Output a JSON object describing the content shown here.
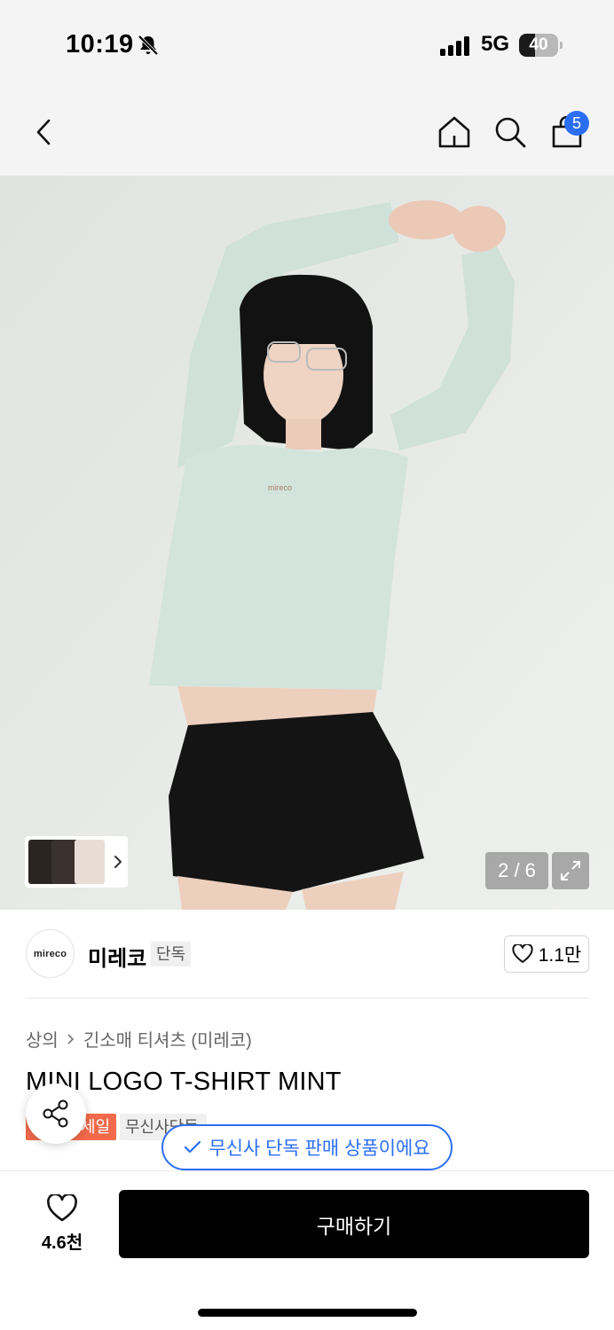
{
  "status_bar": {
    "time": "10:19",
    "network": "5G",
    "battery": "40",
    "battery_level_percent": 40
  },
  "nav": {
    "icons": [
      "chevron-left-icon",
      "home-icon",
      "search-icon",
      "shopping-bag-icon"
    ],
    "cart_count": "5",
    "badge_color": "#2b6ef3"
  },
  "gallery": {
    "counter": "2 / 6",
    "image_logo_text": "mireco"
  },
  "brand": {
    "logo_text": "mireco",
    "name": "미레코",
    "tag": "단독",
    "likes": "1.1만"
  },
  "product": {
    "breadcrumb": [
      "상의",
      "긴소매 티셔츠 (미레코)"
    ],
    "title": "MINI LOGO T-SHIRT MINT",
    "badges": {
      "sale": "세일",
      "exclusive": "무신사단독",
      "sale_color": "#f26a4b"
    }
  },
  "toast": {
    "text": "무신사 단독 판매 상품이에요"
  },
  "bottom": {
    "wish_count": "4.6천",
    "buy_label": "구매하기"
  }
}
